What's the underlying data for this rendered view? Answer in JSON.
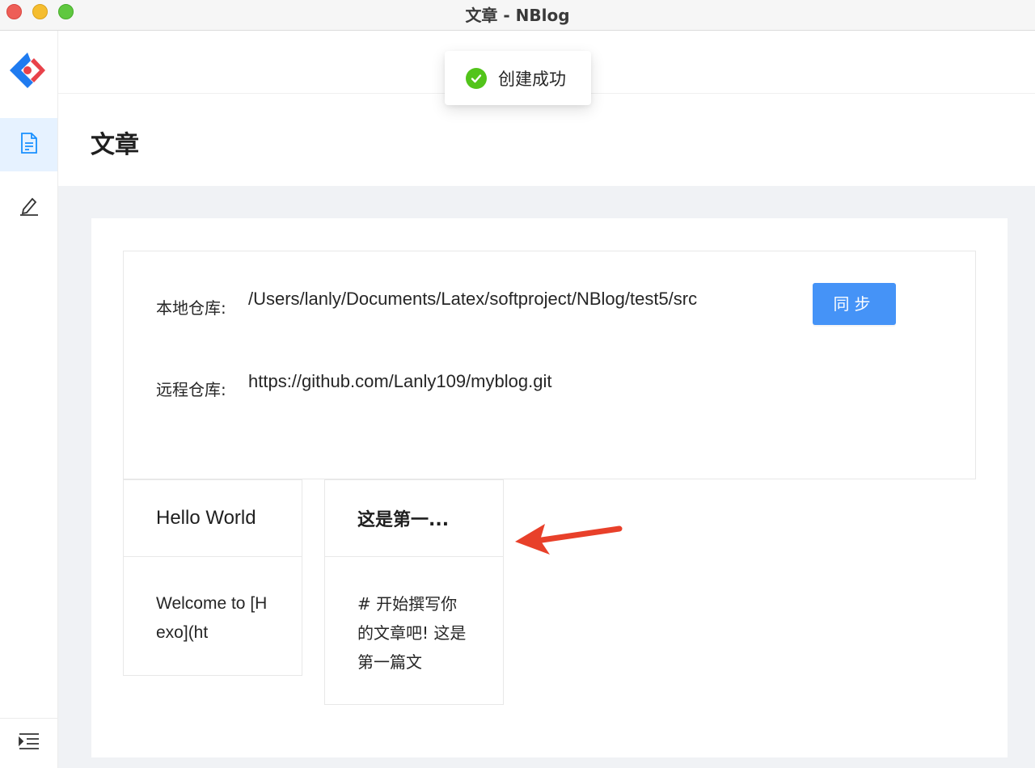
{
  "window": {
    "title": "文章 - NBlog"
  },
  "sidebar": {
    "items": [
      {
        "name": "articles",
        "icon": "document-icon",
        "active": true
      },
      {
        "name": "editor",
        "icon": "edit-icon",
        "active": false
      }
    ],
    "bottom_icon": "menu-indent-icon"
  },
  "toast": {
    "message": "创建成功",
    "type": "success",
    "color": "#52c41a"
  },
  "page": {
    "title": "文章"
  },
  "repo": {
    "local_label": "本地仓库:",
    "local_path": "/Users/lanly/Documents/Latex/softproject/NBlog/test5/src",
    "remote_label": "远程仓库:",
    "remote_url": "https://github.com/Lanly109/myblog.git",
    "sync_label": "同步",
    "accent_color": "#4593f7"
  },
  "posts": [
    {
      "title": "Hello World",
      "excerpt": "Welcome to [Hexo](ht"
    },
    {
      "title": "这是第一...",
      "excerpt": "# 开始撰写你的文章吧! 这是第一篇文"
    }
  ],
  "annotation": {
    "arrow_color": "#e8402a"
  }
}
